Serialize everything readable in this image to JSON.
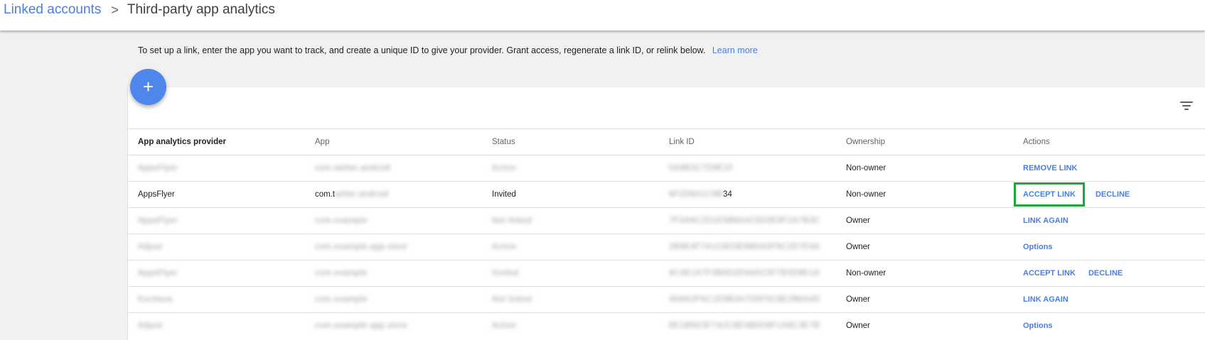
{
  "breadcrumb": {
    "parent": "Linked accounts",
    "separator": ">",
    "current": "Third-party app analytics"
  },
  "intro": {
    "text": "To set up a link, enter the app you want to track, and create a unique ID to give your provider. Grant access, regenerate a link ID, or relink below.",
    "learn_more": "Learn more"
  },
  "fab": {
    "label": "+",
    "icon": "plus-icon"
  },
  "filter": {
    "icon": "filter-icon"
  },
  "table": {
    "headers": [
      "App analytics provider",
      "App",
      "Status",
      "Link ID",
      "Ownership",
      "Actions"
    ],
    "rows": [
      {
        "provider": "AppsFlyer",
        "app": "com.twitter.android",
        "status": "Active",
        "link_id": "5A8B3C7D9E1F",
        "ownership": "Non-owner",
        "actions": [
          "REMOVE LINK"
        ]
      },
      {
        "provider": "AppsFlyer",
        "app": "com.t",
        "app_blur": "witter.android",
        "status": "Invited",
        "link_id_blur": "8F2D6A1C9B",
        "link_id": "34",
        "ownership": "Non-owner",
        "actions": [
          "ACCEPT LINK",
          "DECLINE"
        ]
      },
      {
        "provider": "AppsFlyer",
        "app": "com.example",
        "status": "Not linked",
        "link_id": "7F3A9C2D1E5B8A4C6D0E9F2A7B3C",
        "ownership": "Owner",
        "actions": [
          "LINK AGAIN"
        ]
      },
      {
        "provider": "Adjust",
        "app": "com.example.app.store",
        "status": "Active",
        "link_id": "2B9E4F7A1C6D3E8B5A0F9C2D7E4A",
        "ownership": "Owner",
        "actions": [
          "Options"
        ]
      },
      {
        "provider": "AppsFlyer",
        "app": "com.example",
        "status": "Invited",
        "link_id": "9C4E1A7F3B6D2E8A5C0F7B3D9E1A",
        "ownership": "Non-owner",
        "actions": [
          "ACCEPT LINK",
          "DECLINE"
        ]
      },
      {
        "provider": "Kochava",
        "app": "com.example",
        "status": "Not linked",
        "link_id": "4D8A2F6C1E9B3A7D5F0C8E2B6A4D",
        "ownership": "Owner",
        "actions": [
          "LINK AGAIN"
        ]
      },
      {
        "provider": "Adjust",
        "app": "com.example.app.store",
        "status": "Active",
        "link_id": "6E1B9D3F7A2C8E4B0D6F1A9C3E7B",
        "ownership": "Owner",
        "actions": [
          "Options"
        ]
      }
    ]
  }
}
